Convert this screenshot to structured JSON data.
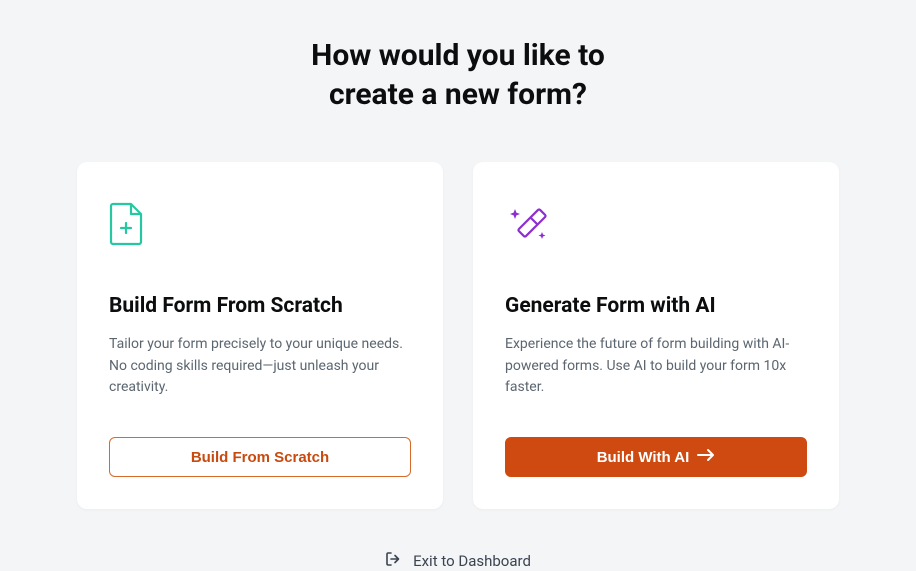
{
  "heading_line1": "How would you like to",
  "heading_line2": "create a new form?",
  "cards": {
    "scratch": {
      "title": "Build Form From Scratch",
      "description": "Tailor your form precisely to your unique needs. No coding skills required—just unleash your creativity.",
      "button_label": "Build From Scratch"
    },
    "ai": {
      "title": "Generate Form with AI",
      "description": "Experience the future of form building with AI-powered forms. Use AI to build your form 10x faster.",
      "button_label": "Build With AI"
    }
  },
  "exit_label": "Exit to Dashboard",
  "colors": {
    "accent": "#cf4a10",
    "accent_border": "#d66a2a",
    "page_bg": "#f3f5f7",
    "card_bg": "#ffffff",
    "text_heading": "#0c0d0e",
    "text_muted": "#5b6670"
  },
  "icons": {
    "scratch": "file-plus",
    "ai": "magic-wand",
    "exit": "exit-door",
    "arrow": "arrow-right"
  }
}
